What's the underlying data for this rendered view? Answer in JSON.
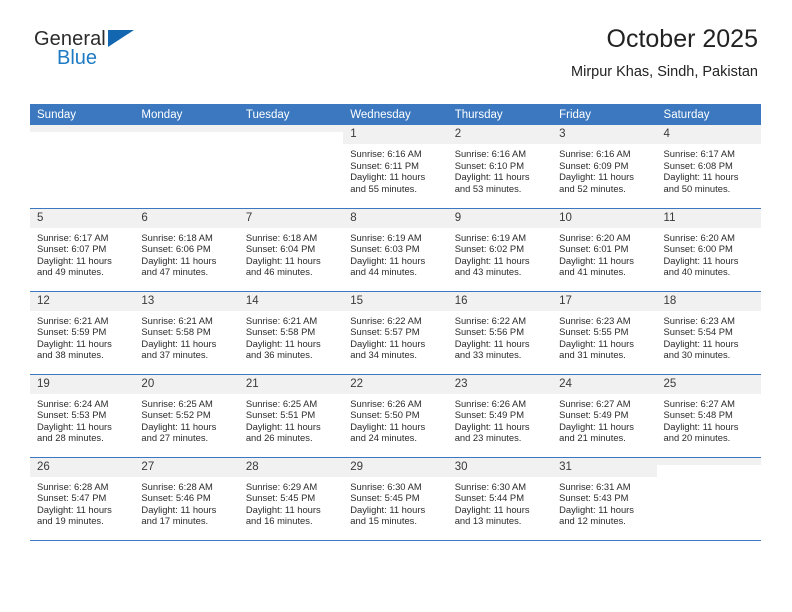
{
  "brand": {
    "name_top": "General",
    "name_bottom": "Blue",
    "triangle_color": "#1367b0",
    "blue_color": "#1f7ac4"
  },
  "header": {
    "title": "October 2025",
    "location": "Mirpur Khas, Sindh, Pakistan"
  },
  "theme": {
    "header_row_bg": "#3b78bf",
    "header_row_text": "#ffffff",
    "daynum_bg": "#f1f1f1",
    "row_divider": "#3b78bf",
    "body_text": "#2b2b2b"
  },
  "weekday_headers": [
    "Sunday",
    "Monday",
    "Tuesday",
    "Wednesday",
    "Thursday",
    "Friday",
    "Saturday"
  ],
  "labels": {
    "sunrise_prefix": "Sunrise:",
    "sunset_prefix": "Sunset:",
    "daylight_prefix": "Daylight:"
  },
  "weeks": [
    [
      {
        "day": "",
        "empty": true,
        "sunrise": "",
        "sunset": "",
        "daylight_l1": "",
        "daylight_l2": ""
      },
      {
        "day": "",
        "empty": true,
        "sunrise": "",
        "sunset": "",
        "daylight_l1": "",
        "daylight_l2": ""
      },
      {
        "day": "",
        "empty": true,
        "sunrise": "",
        "sunset": "",
        "daylight_l1": "",
        "daylight_l2": ""
      },
      {
        "day": "1",
        "empty": false,
        "sunrise": "Sunrise: 6:16 AM",
        "sunset": "Sunset: 6:11 PM",
        "daylight_l1": "Daylight: 11 hours",
        "daylight_l2": "and 55 minutes."
      },
      {
        "day": "2",
        "empty": false,
        "sunrise": "Sunrise: 6:16 AM",
        "sunset": "Sunset: 6:10 PM",
        "daylight_l1": "Daylight: 11 hours",
        "daylight_l2": "and 53 minutes."
      },
      {
        "day": "3",
        "empty": false,
        "sunrise": "Sunrise: 6:16 AM",
        "sunset": "Sunset: 6:09 PM",
        "daylight_l1": "Daylight: 11 hours",
        "daylight_l2": "and 52 minutes."
      },
      {
        "day": "4",
        "empty": false,
        "sunrise": "Sunrise: 6:17 AM",
        "sunset": "Sunset: 6:08 PM",
        "daylight_l1": "Daylight: 11 hours",
        "daylight_l2": "and 50 minutes."
      }
    ],
    [
      {
        "day": "5",
        "empty": false,
        "sunrise": "Sunrise: 6:17 AM",
        "sunset": "Sunset: 6:07 PM",
        "daylight_l1": "Daylight: 11 hours",
        "daylight_l2": "and 49 minutes."
      },
      {
        "day": "6",
        "empty": false,
        "sunrise": "Sunrise: 6:18 AM",
        "sunset": "Sunset: 6:06 PM",
        "daylight_l1": "Daylight: 11 hours",
        "daylight_l2": "and 47 minutes."
      },
      {
        "day": "7",
        "empty": false,
        "sunrise": "Sunrise: 6:18 AM",
        "sunset": "Sunset: 6:04 PM",
        "daylight_l1": "Daylight: 11 hours",
        "daylight_l2": "and 46 minutes."
      },
      {
        "day": "8",
        "empty": false,
        "sunrise": "Sunrise: 6:19 AM",
        "sunset": "Sunset: 6:03 PM",
        "daylight_l1": "Daylight: 11 hours",
        "daylight_l2": "and 44 minutes."
      },
      {
        "day": "9",
        "empty": false,
        "sunrise": "Sunrise: 6:19 AM",
        "sunset": "Sunset: 6:02 PM",
        "daylight_l1": "Daylight: 11 hours",
        "daylight_l2": "and 43 minutes."
      },
      {
        "day": "10",
        "empty": false,
        "sunrise": "Sunrise: 6:20 AM",
        "sunset": "Sunset: 6:01 PM",
        "daylight_l1": "Daylight: 11 hours",
        "daylight_l2": "and 41 minutes."
      },
      {
        "day": "11",
        "empty": false,
        "sunrise": "Sunrise: 6:20 AM",
        "sunset": "Sunset: 6:00 PM",
        "daylight_l1": "Daylight: 11 hours",
        "daylight_l2": "and 40 minutes."
      }
    ],
    [
      {
        "day": "12",
        "empty": false,
        "sunrise": "Sunrise: 6:21 AM",
        "sunset": "Sunset: 5:59 PM",
        "daylight_l1": "Daylight: 11 hours",
        "daylight_l2": "and 38 minutes."
      },
      {
        "day": "13",
        "empty": false,
        "sunrise": "Sunrise: 6:21 AM",
        "sunset": "Sunset: 5:58 PM",
        "daylight_l1": "Daylight: 11 hours",
        "daylight_l2": "and 37 minutes."
      },
      {
        "day": "14",
        "empty": false,
        "sunrise": "Sunrise: 6:21 AM",
        "sunset": "Sunset: 5:58 PM",
        "daylight_l1": "Daylight: 11 hours",
        "daylight_l2": "and 36 minutes."
      },
      {
        "day": "15",
        "empty": false,
        "sunrise": "Sunrise: 6:22 AM",
        "sunset": "Sunset: 5:57 PM",
        "daylight_l1": "Daylight: 11 hours",
        "daylight_l2": "and 34 minutes."
      },
      {
        "day": "16",
        "empty": false,
        "sunrise": "Sunrise: 6:22 AM",
        "sunset": "Sunset: 5:56 PM",
        "daylight_l1": "Daylight: 11 hours",
        "daylight_l2": "and 33 minutes."
      },
      {
        "day": "17",
        "empty": false,
        "sunrise": "Sunrise: 6:23 AM",
        "sunset": "Sunset: 5:55 PM",
        "daylight_l1": "Daylight: 11 hours",
        "daylight_l2": "and 31 minutes."
      },
      {
        "day": "18",
        "empty": false,
        "sunrise": "Sunrise: 6:23 AM",
        "sunset": "Sunset: 5:54 PM",
        "daylight_l1": "Daylight: 11 hours",
        "daylight_l2": "and 30 minutes."
      }
    ],
    [
      {
        "day": "19",
        "empty": false,
        "sunrise": "Sunrise: 6:24 AM",
        "sunset": "Sunset: 5:53 PM",
        "daylight_l1": "Daylight: 11 hours",
        "daylight_l2": "and 28 minutes."
      },
      {
        "day": "20",
        "empty": false,
        "sunrise": "Sunrise: 6:25 AM",
        "sunset": "Sunset: 5:52 PM",
        "daylight_l1": "Daylight: 11 hours",
        "daylight_l2": "and 27 minutes."
      },
      {
        "day": "21",
        "empty": false,
        "sunrise": "Sunrise: 6:25 AM",
        "sunset": "Sunset: 5:51 PM",
        "daylight_l1": "Daylight: 11 hours",
        "daylight_l2": "and 26 minutes."
      },
      {
        "day": "22",
        "empty": false,
        "sunrise": "Sunrise: 6:26 AM",
        "sunset": "Sunset: 5:50 PM",
        "daylight_l1": "Daylight: 11 hours",
        "daylight_l2": "and 24 minutes."
      },
      {
        "day": "23",
        "empty": false,
        "sunrise": "Sunrise: 6:26 AM",
        "sunset": "Sunset: 5:49 PM",
        "daylight_l1": "Daylight: 11 hours",
        "daylight_l2": "and 23 minutes."
      },
      {
        "day": "24",
        "empty": false,
        "sunrise": "Sunrise: 6:27 AM",
        "sunset": "Sunset: 5:49 PM",
        "daylight_l1": "Daylight: 11 hours",
        "daylight_l2": "and 21 minutes."
      },
      {
        "day": "25",
        "empty": false,
        "sunrise": "Sunrise: 6:27 AM",
        "sunset": "Sunset: 5:48 PM",
        "daylight_l1": "Daylight: 11 hours",
        "daylight_l2": "and 20 minutes."
      }
    ],
    [
      {
        "day": "26",
        "empty": false,
        "sunrise": "Sunrise: 6:28 AM",
        "sunset": "Sunset: 5:47 PM",
        "daylight_l1": "Daylight: 11 hours",
        "daylight_l2": "and 19 minutes."
      },
      {
        "day": "27",
        "empty": false,
        "sunrise": "Sunrise: 6:28 AM",
        "sunset": "Sunset: 5:46 PM",
        "daylight_l1": "Daylight: 11 hours",
        "daylight_l2": "and 17 minutes."
      },
      {
        "day": "28",
        "empty": false,
        "sunrise": "Sunrise: 6:29 AM",
        "sunset": "Sunset: 5:45 PM",
        "daylight_l1": "Daylight: 11 hours",
        "daylight_l2": "and 16 minutes."
      },
      {
        "day": "29",
        "empty": false,
        "sunrise": "Sunrise: 6:30 AM",
        "sunset": "Sunset: 5:45 PM",
        "daylight_l1": "Daylight: 11 hours",
        "daylight_l2": "and 15 minutes."
      },
      {
        "day": "30",
        "empty": false,
        "sunrise": "Sunrise: 6:30 AM",
        "sunset": "Sunset: 5:44 PM",
        "daylight_l1": "Daylight: 11 hours",
        "daylight_l2": "and 13 minutes."
      },
      {
        "day": "31",
        "empty": false,
        "sunrise": "Sunrise: 6:31 AM",
        "sunset": "Sunset: 5:43 PM",
        "daylight_l1": "Daylight: 11 hours",
        "daylight_l2": "and 12 minutes."
      },
      {
        "day": "",
        "empty": true,
        "sunrise": "",
        "sunset": "",
        "daylight_l1": "",
        "daylight_l2": ""
      }
    ]
  ]
}
